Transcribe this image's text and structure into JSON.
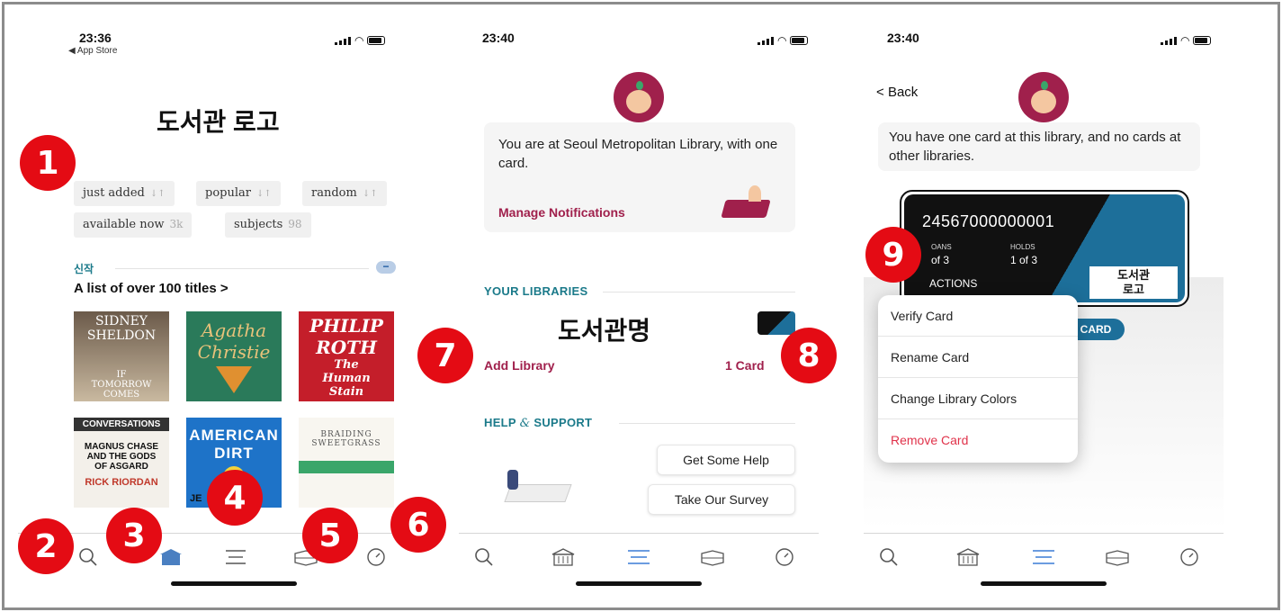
{
  "colors": {
    "accent_pink": "#a0204c",
    "teal": "#1b7a8a",
    "badge_red": "#e40b14",
    "tab_active": "#3a7bd5"
  },
  "screen1": {
    "time": "23:36",
    "back_app": "◀ App Store",
    "logo_title": "도서관 로고",
    "chips": [
      {
        "label": "just added"
      },
      {
        "label": "popular"
      },
      {
        "label": "random"
      },
      {
        "label": "available now",
        "count": "3k"
      },
      {
        "label": "subjects",
        "count": "98"
      }
    ],
    "section_label": "신작",
    "list_link": "A list of over 100 titles",
    "books": [
      {
        "line1": "SIDNEY",
        "line2": "SHELDON",
        "line3": "IF TOMORROW COMES"
      },
      {
        "line1": "Agatha",
        "line2": "Christie",
        "line3": ""
      },
      {
        "line1": "PHILIP",
        "line2": "ROTH",
        "line3": "The Human Stain"
      },
      {
        "line1": "CONVERSATIONS",
        "line2": "MAGNUS CHASE AND THE GODS OF ASGARD",
        "line3": "RICK RIORDAN"
      },
      {
        "line1": "AMERICAN",
        "line2": "DIRT",
        "line3": "JE"
      },
      {
        "line1": "BRAIDING",
        "line2": "SWEETGRASS",
        "line3": ""
      }
    ]
  },
  "screen2": {
    "time": "23:40",
    "status_text": "You are at Seoul Metropolitan Library, with one card.",
    "manage_notifications": "Manage Notifications",
    "your_libraries": "YOUR LIBRARIES",
    "library_name": "도서관명",
    "add_library": "Add Library",
    "card_count": "1 Card",
    "help_support": "HELP",
    "help_support_amp": "&",
    "help_support_2": "SUPPORT",
    "get_help": "Get Some Help",
    "take_survey": "Take Our Survey"
  },
  "screen3": {
    "time": "23:40",
    "back": "Back",
    "info_text": "You have one card at this library, and no cards at other libraries.",
    "card_number": "24567000000001",
    "loans_label": "OANS",
    "loans_value": "of 3",
    "holds_label": "HOLDS",
    "holds_value": "1 of 3",
    "actions_label": "ACTIONS",
    "logo_text_1": "도서관",
    "logo_text_2": "로고",
    "card_pill": "CARD",
    "menu_items": [
      "Verify Card",
      "Rename Card",
      "Change Library Colors",
      "Remove Card"
    ]
  },
  "badges": [
    "1",
    "2",
    "3",
    "4",
    "5",
    "6",
    "7",
    "8",
    "9"
  ]
}
